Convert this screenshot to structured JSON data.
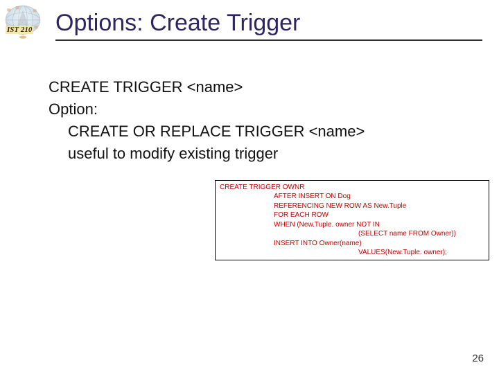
{
  "logo_badge": "IST 210",
  "title": "Options: Create Trigger",
  "body": {
    "line1": "CREATE TRIGGER <name>",
    "line2": "Option:",
    "line3": "CREATE OR REPLACE TRIGGER <name>",
    "line4": "useful to modify existing trigger"
  },
  "codebox": {
    "l1": "CREATE TRIGGER OWNR",
    "l2": "AFTER INSERT ON Dog",
    "l3": "REFERENCING NEW ROW AS New.Tuple",
    "l4": "FOR EACH ROW",
    "l5": "WHEN (New.Tuple. owner NOT IN",
    "l6": "(SELECT name FROM Owner))",
    "l7": "INSERT INTO Owner(name)",
    "l8": "VALUES(New.Tuple. owner);"
  },
  "slide_number": "26"
}
